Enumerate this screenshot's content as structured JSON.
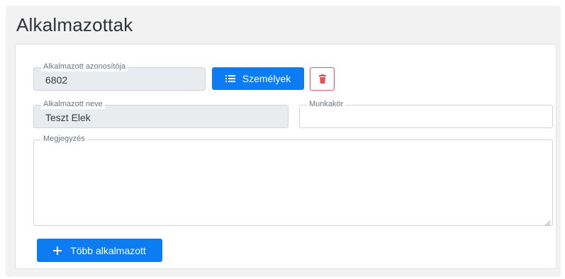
{
  "page": {
    "title": "Alkalmazottak"
  },
  "form": {
    "employee_id": {
      "label": "Alkalmazott azonosítója",
      "value": "6802"
    },
    "persons_button": {
      "label": "Személyek",
      "icon": "list-icon"
    },
    "delete_button": {
      "icon": "trash-icon"
    },
    "employee_name": {
      "label": "Alkalmazott neve",
      "value": "Teszt Elek"
    },
    "job_title": {
      "label": "Munkakör",
      "value": ""
    },
    "note": {
      "label": "Megjegyzés",
      "value": ""
    },
    "more_button": {
      "label": "Több alkalmazott",
      "icon": "plus-icon"
    }
  },
  "colors": {
    "primary": "#0d7cf2",
    "danger": "#e0525f",
    "readonly_bg": "#e9ecef",
    "outer_bg": "#f2f2f3"
  }
}
